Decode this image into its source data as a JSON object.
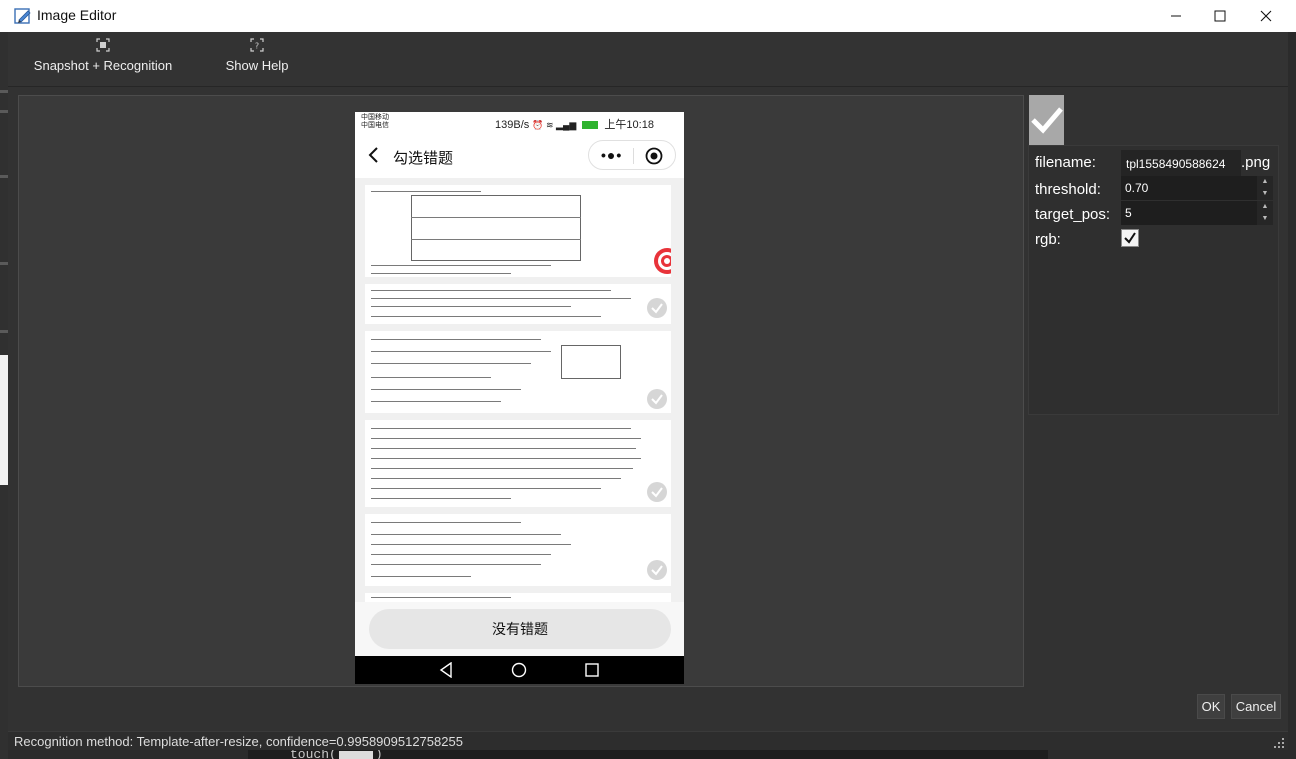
{
  "window": {
    "title": "Image Editor"
  },
  "toolbar": {
    "snapshot_label": "Snapshot + Recognition",
    "help_label": "Show Help"
  },
  "phone": {
    "status_left_1": "中国移动",
    "status_left_2": "中国电信",
    "status_right": "139B/s",
    "battery": "100",
    "time": "上午10:18",
    "nav_title": "勾选错题",
    "no_error_button": "没有错题"
  },
  "properties": {
    "filename_label": "filename:",
    "filename_value": "tpl1558490588624",
    "filename_ext": ".png",
    "threshold_label": "threshold:",
    "threshold_value": "0.70",
    "target_pos_label": "target_pos:",
    "target_pos_value": "5",
    "rgb_label": "rgb:",
    "rgb_checked": true
  },
  "buttons": {
    "ok": "OK",
    "cancel": "Cancel"
  },
  "status": {
    "message": "Recognition method: Template-after-resize, confidence=0.9958909512758255"
  },
  "background": {
    "code_fragment": "touch("
  },
  "colors": {
    "window_bg": "#323232",
    "canvas_bg": "#3a3a3a",
    "titlebar_bg": "#ffffff",
    "target_red": "#e8333a"
  }
}
